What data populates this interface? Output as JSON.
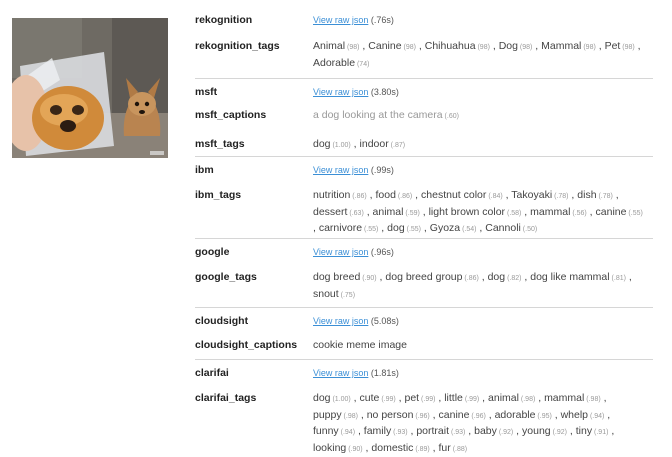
{
  "rows": [
    {
      "key": "rekognition",
      "type": "link",
      "link_text": "View raw json",
      "time": "(.76s)"
    },
    {
      "key": "rekognition_tags",
      "type": "tags",
      "tags": [
        {
          "t": "Animal",
          "s": "(98)"
        },
        {
          "t": "Canine",
          "s": "(98)"
        },
        {
          "t": "Chihuahua",
          "s": "(98)"
        },
        {
          "t": "Dog",
          "s": "(98)"
        },
        {
          "t": "Mammal",
          "s": "(98)"
        },
        {
          "t": "Pet",
          "s": "(98)"
        },
        {
          "t": "Adorable",
          "s": "(74)"
        }
      ]
    },
    {
      "key": "msft",
      "type": "link",
      "link_text": "View raw json",
      "time": "(3.80s)"
    },
    {
      "key": "msft_captions",
      "type": "caption",
      "text": "a dog looking at the camera",
      "score": "(.60)"
    },
    {
      "key": "msft_tags",
      "type": "tags",
      "tags": [
        {
          "t": "dog",
          "s": "(1.00)"
        },
        {
          "t": "indoor",
          "s": "(.87)"
        }
      ]
    },
    {
      "key": "ibm",
      "type": "link",
      "link_text": "View raw json",
      "time": "(.99s)"
    },
    {
      "key": "ibm_tags",
      "type": "tags",
      "tags": [
        {
          "t": "nutrition",
          "s": "(.86)"
        },
        {
          "t": "food",
          "s": "(.86)"
        },
        {
          "t": "chestnut color",
          "s": "(.84)"
        },
        {
          "t": "Takoyaki",
          "s": "(.78)"
        },
        {
          "t": "dish",
          "s": "(.78)"
        },
        {
          "t": "dessert",
          "s": "(.63)"
        },
        {
          "t": "animal",
          "s": "(.59)"
        },
        {
          "t": "light brown color",
          "s": "(.58)"
        },
        {
          "t": "mammal",
          "s": "(.56)"
        },
        {
          "t": "canine",
          "s": "(.55)"
        },
        {
          "t": "carnivore",
          "s": "(.55)"
        },
        {
          "t": "dog",
          "s": "(.55)"
        },
        {
          "t": "Gyoza",
          "s": "(.54)"
        },
        {
          "t": "Cannoli",
          "s": "(.50)"
        }
      ]
    },
    {
      "key": "google",
      "type": "link",
      "link_text": "View raw json",
      "time": "(.96s)"
    },
    {
      "key": "google_tags",
      "type": "tags",
      "tags": [
        {
          "t": "dog breed",
          "s": "(.90)"
        },
        {
          "t": "dog breed group",
          "s": "(.86)"
        },
        {
          "t": "dog",
          "s": "(.82)"
        },
        {
          "t": "dog like mammal",
          "s": "(.81)"
        },
        {
          "t": "snout",
          "s": "(.75)"
        }
      ]
    },
    {
      "key": "cloudsight",
      "type": "link",
      "link_text": "View raw json",
      "time": "(5.08s)"
    },
    {
      "key": "cloudsight_captions",
      "type": "plain",
      "text": "cookie meme image"
    },
    {
      "key": "clarifai",
      "type": "link",
      "link_text": "View raw json",
      "time": "(1.81s)"
    },
    {
      "key": "clarifai_tags",
      "type": "tags",
      "tags": [
        {
          "t": "dog",
          "s": "(1.00)"
        },
        {
          "t": "cute",
          "s": "(.99)"
        },
        {
          "t": "pet",
          "s": "(.99)"
        },
        {
          "t": "little",
          "s": "(.99)"
        },
        {
          "t": "animal",
          "s": "(.98)"
        },
        {
          "t": "mammal",
          "s": "(.98)"
        },
        {
          "t": "puppy",
          "s": "(.98)"
        },
        {
          "t": "no person",
          "s": "(.96)"
        },
        {
          "t": "canine",
          "s": "(.96)"
        },
        {
          "t": "adorable",
          "s": "(.95)"
        },
        {
          "t": "whelp",
          "s": "(.94)"
        },
        {
          "t": "funny",
          "s": "(.94)"
        },
        {
          "t": "family",
          "s": "(.93)"
        },
        {
          "t": "portrait",
          "s": "(.93)"
        },
        {
          "t": "baby",
          "s": "(.92)"
        },
        {
          "t": "young",
          "s": "(.92)"
        },
        {
          "t": "tiny",
          "s": "(.91)"
        },
        {
          "t": "looking",
          "s": "(.90)"
        },
        {
          "t": "domestic",
          "s": "(.89)"
        },
        {
          "t": "fur",
          "s": "(.88)"
        }
      ]
    }
  ],
  "colors": {
    "link": "#3b8fd6",
    "separator": "#d6d6d6",
    "label": "#222222",
    "score": "#9a9a9a"
  }
}
